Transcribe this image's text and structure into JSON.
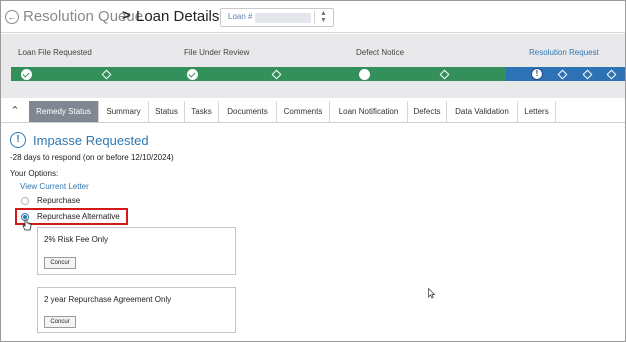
{
  "header": {
    "back_icon": "arrow-left-icon",
    "breadcrumb_link": "Resolution Queue",
    "breadcrumb_separator": ">",
    "page_title": "Loan Details",
    "loan_label": "Loan #",
    "loan_value": ""
  },
  "progress": {
    "steps": [
      {
        "label": "Loan File Requested"
      },
      {
        "label": "File Under Review"
      },
      {
        "label": "Defect Notice"
      },
      {
        "label": "Resolution Request"
      }
    ],
    "complete_color": "#33905a",
    "current_color": "#2d72b5"
  },
  "tabs": {
    "collapse_icon": "chevron-up-icon",
    "items": [
      {
        "label": "Remedy Status"
      },
      {
        "label": "Summary"
      },
      {
        "label": "Status"
      },
      {
        "label": "Tasks"
      },
      {
        "label": "Documents"
      },
      {
        "label": "Comments"
      },
      {
        "label": "Loan Notification"
      },
      {
        "label": "Defects"
      },
      {
        "label": "Data Validation"
      },
      {
        "label": "Letters"
      }
    ],
    "active": "Remedy Status"
  },
  "remedy": {
    "icon": "alert-circle-icon",
    "title": "Impasse Requested",
    "respond_text": "-28 days to respond (on or before 12/10/2024)",
    "options_label": "Your Options:",
    "view_letter": "View Current Letter",
    "radio_options": [
      {
        "label": "Repurchase",
        "selected": false
      },
      {
        "label": "Repurchase Alternative",
        "selected": true
      }
    ],
    "alternatives": [
      {
        "title": "2% Risk Fee Only",
        "button": "Concur"
      },
      {
        "title": "2 year Repurchase Agreement Only",
        "button": "Concur"
      }
    ]
  },
  "accent_color": "#2f78b3",
  "highlight_color": "#d11a1a"
}
